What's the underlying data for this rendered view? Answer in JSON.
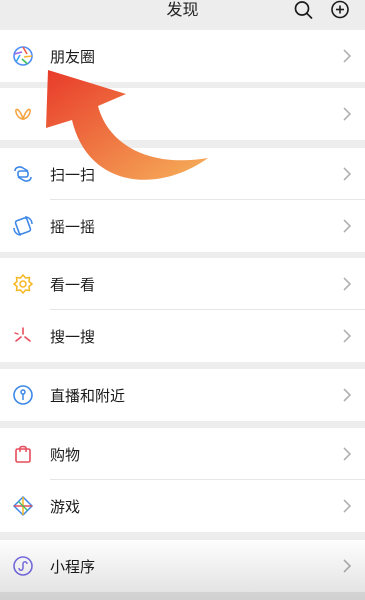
{
  "header": {
    "title": "发现",
    "search_icon": "search-icon",
    "add_icon": "plus-circle-icon"
  },
  "menu": {
    "moments": {
      "label": "朋友圈",
      "icon": "aperture-icon"
    },
    "channels": {
      "label": "",
      "icon": "butterfly-icon"
    },
    "scan": {
      "label": "扫一扫",
      "icon": "scan-icon"
    },
    "shake": {
      "label": "摇一摇",
      "icon": "shake-icon"
    },
    "top_stories": {
      "label": "看一看",
      "icon": "look-icon"
    },
    "search": {
      "label": "搜一搜",
      "icon": "search-sparkle-icon"
    },
    "live_nearby": {
      "label": "直播和附近",
      "icon": "live-nearby-icon"
    },
    "shopping": {
      "label": "购物",
      "icon": "shopping-bag-icon"
    },
    "games": {
      "label": "游戏",
      "icon": "diamond-game-icon"
    },
    "mini_programs": {
      "label": "小程序",
      "icon": "mini-program-icon"
    }
  },
  "colors": {
    "background": "#ededed",
    "arrow_gradient_start": "#e83a2a",
    "arrow_gradient_end": "#f6b15a"
  }
}
